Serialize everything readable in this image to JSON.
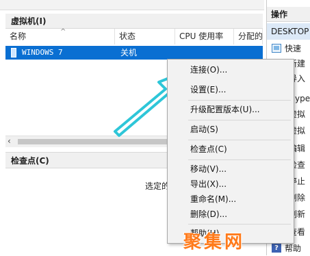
{
  "vm_panel": {
    "title": "虚拟机(I)",
    "columns": [
      "名称",
      "状态",
      "CPU 使用率",
      "分配的"
    ],
    "rows": [
      {
        "name": "WINDOWS 7",
        "state": "关机"
      }
    ]
  },
  "checkpoint_panel": {
    "title": "检查点(C)",
    "empty_text": "选定的"
  },
  "actions_panel": {
    "title": "操作",
    "host": "DESKTOP",
    "items": [
      {
        "icon": "quick-create-icon",
        "label": "快速"
      },
      {
        "icon": "",
        "label": "新建"
      },
      {
        "icon": "",
        "label": "导入"
      },
      {
        "icon": "",
        "label": "Hype"
      },
      {
        "icon": "",
        "label": "虚拟"
      },
      {
        "icon": "",
        "label": "虚拟"
      },
      {
        "icon": "",
        "label": "编辑"
      },
      {
        "icon": "",
        "label": "检查"
      },
      {
        "icon": "",
        "label": "停止"
      },
      {
        "icon": "",
        "label": "删除"
      },
      {
        "icon": "",
        "label": "刷新"
      },
      {
        "icon": "",
        "label": "查看"
      },
      {
        "icon": "help-icon",
        "label": "帮助"
      }
    ]
  },
  "context_menu": {
    "items": [
      {
        "label": "连接(O)..."
      },
      {
        "label": "设置(E)..."
      },
      {
        "label": "升级配置版本(U)..."
      },
      {
        "label": "启动(S)"
      },
      {
        "label": "检查点(C)"
      },
      {
        "label": "移动(V)..."
      },
      {
        "label": "导出(X)..."
      },
      {
        "label": "重命名(M)..."
      },
      {
        "label": "删除(D)..."
      },
      {
        "label": "帮助(H)"
      }
    ]
  },
  "watermark": "聚集网",
  "colors": {
    "selection": "#0a6fd2",
    "arrow": "#2ec6d8",
    "watermark": "#ff7a1a"
  }
}
